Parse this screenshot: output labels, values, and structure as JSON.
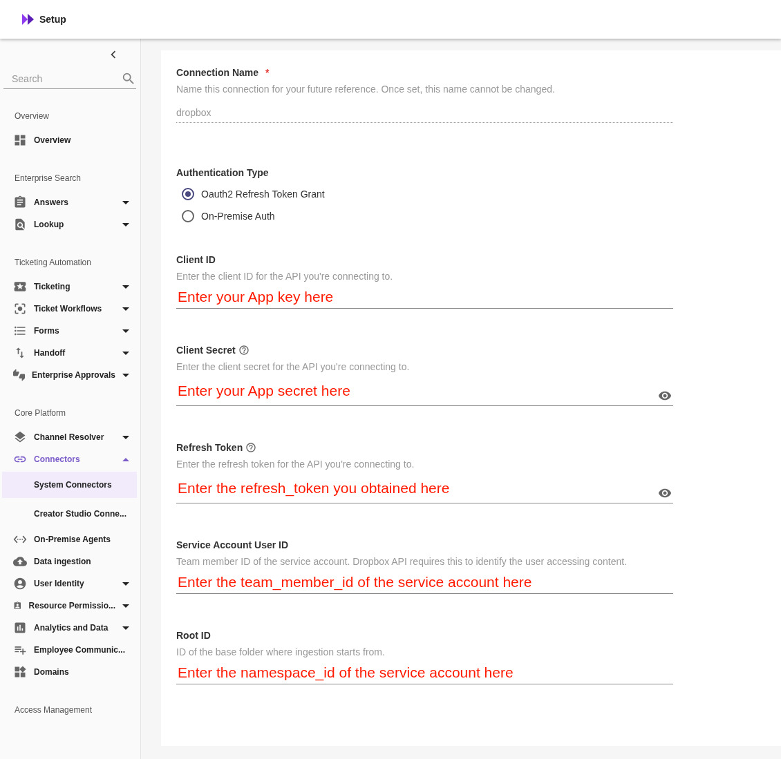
{
  "header": {
    "title": "Setup"
  },
  "sidebar": {
    "search": {
      "placeholder": "Search"
    },
    "sections": [
      {
        "title": "Overview",
        "items": [
          {
            "label": "Overview",
            "selected": false
          }
        ]
      },
      {
        "title": "Enterprise Search",
        "items": [
          {
            "label": "Answers",
            "selected": false,
            "expanded": false
          },
          {
            "label": "Lookup",
            "selected": false,
            "expanded": false
          }
        ]
      },
      {
        "title": "Ticketing Automation",
        "items": [
          {
            "label": "Ticketing",
            "selected": false,
            "expanded": false
          },
          {
            "label": "Ticket Workflows",
            "selected": false,
            "expanded": false
          },
          {
            "label": "Forms",
            "selected": false,
            "expanded": false
          },
          {
            "label": "Handoff",
            "selected": false,
            "expanded": false
          },
          {
            "label": "Enterprise Approvals",
            "selected": false,
            "expanded": false
          }
        ]
      },
      {
        "title": "Core Platform",
        "items": [
          {
            "label": "Channel Resolver",
            "selected": false,
            "expanded": false
          },
          {
            "label": "Connectors",
            "selected": true,
            "expanded": true,
            "children": [
              {
                "label": "System Connectors",
                "selected": true
              },
              {
                "label": "Creator Studio Conne...",
                "selected": false
              }
            ]
          },
          {
            "label": "On-Premise Agents",
            "selected": false
          },
          {
            "label": "Data ingestion",
            "selected": false
          },
          {
            "label": "User Identity",
            "selected": false,
            "expanded": false
          },
          {
            "label": "Resource Permissio...",
            "selected": false,
            "expanded": false
          },
          {
            "label": "Analytics and Data",
            "selected": false,
            "expanded": false
          },
          {
            "label": "Employee Communic...",
            "selected": false
          },
          {
            "label": "Domains",
            "selected": false
          }
        ]
      },
      {
        "title": "Access Management"
      }
    ]
  },
  "form": {
    "connection_name": {
      "label": "Connection Name",
      "required_mark": "*",
      "description": "Name this connection for your future reference. Once set, this name cannot be changed.",
      "value": "dropbox",
      "disabled": true
    },
    "authentication_type": {
      "label": "Authentication Type",
      "options": [
        {
          "label": "Oauth2 Refresh Token Grant",
          "selected": true
        },
        {
          "label": "On-Premise Auth",
          "selected": false
        }
      ]
    },
    "fields": [
      {
        "label": "Client ID",
        "help": false,
        "secret": false,
        "description": "Enter the client ID for the API you're connecting to.",
        "value": "Enter your App key here"
      },
      {
        "label": "Client Secret",
        "help": true,
        "secret": true,
        "description": "Enter the client secret for the API you're connecting to.",
        "value": "Enter your App secret here"
      },
      {
        "label": "Refresh Token",
        "help": true,
        "secret": true,
        "description": "Enter the refresh token for the API you're connecting to.",
        "value": "Enter the refresh_token you obtained here"
      },
      {
        "label": "Service Account User ID",
        "help": false,
        "secret": false,
        "description": "Team member ID of the service account. Dropbox API requires this to identify the user accessing content.",
        "value": "Enter the team_member_id of the service account here"
      },
      {
        "label": "Root ID",
        "help": false,
        "secret": false,
        "description": "ID of the base folder where ingestion starts from.",
        "value": "Enter the namespace_id of the service account here"
      }
    ]
  }
}
